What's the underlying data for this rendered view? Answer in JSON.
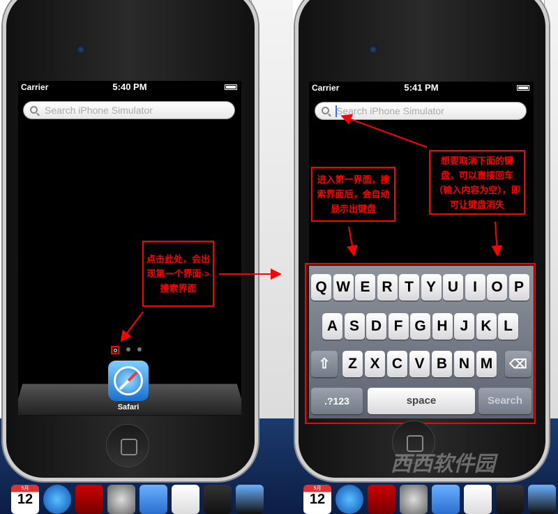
{
  "left_phone": {
    "status": {
      "carrier": "Carrier",
      "time": "5:40 PM"
    },
    "search_placeholder": "Search iPhone Simulator",
    "app": {
      "label": "Safari"
    },
    "annotation": "点击此处，会出现第一个界面->搜索界面"
  },
  "right_phone": {
    "status": {
      "carrier": "Carrier",
      "time": "5:41 PM"
    },
    "search_placeholder": "Search iPhone Simulator",
    "annotation_left": "进入第一界面，搜索界面后，会自动显示出键盘",
    "annotation_right": "想要取消下面的键盘，可以直接回车（输入内容为空），即可让键盘消失",
    "keyboard": {
      "row1": [
        "Q",
        "W",
        "E",
        "R",
        "T",
        "Y",
        "U",
        "I",
        "O",
        "P"
      ],
      "row2": [
        "A",
        "S",
        "D",
        "F",
        "G",
        "H",
        "J",
        "K",
        "L"
      ],
      "row3": [
        "Z",
        "X",
        "C",
        "V",
        "B",
        "N",
        "M"
      ],
      "numbers_key": ".?123",
      "space_key": "space",
      "search_key": "Search"
    }
  },
  "dock": {
    "calendar_day": "12",
    "calendar_month": "5月",
    "icons": [
      "calendar-icon",
      "itunes-icon",
      "photo-booth-icon",
      "system-preferences-icon",
      "xcode-icon",
      "textedit-icon",
      "terminal-icon",
      "ios-simulator-icon"
    ]
  },
  "watermark": "西西软件园",
  "colors": {
    "annotation": "#ff0000",
    "cursor": "#3a6bff"
  }
}
